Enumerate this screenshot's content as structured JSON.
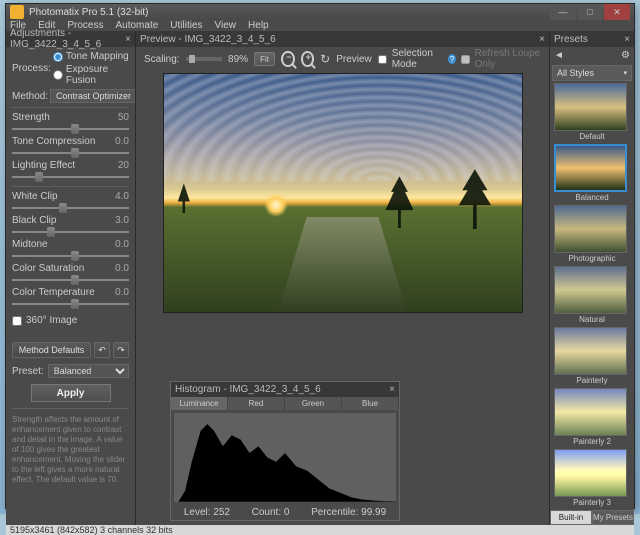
{
  "title": "Photomatix Pro 5.1 (32-bit)",
  "menu": [
    "File",
    "Edit",
    "Process",
    "Automate",
    "Utilities",
    "View",
    "Help"
  ],
  "adjust": {
    "title": "Adjustments - IMG_3422_3_4_5_6",
    "process_label": "Process:",
    "process_opts": [
      "Tone Mapping",
      "Exposure Fusion"
    ],
    "method_label": "Method:",
    "method_value": "Contrast Optimizer",
    "sliders": [
      {
        "label": "Strength",
        "value": "50",
        "pos": 50
      },
      {
        "label": "Tone Compression",
        "value": "0.0",
        "pos": 50
      },
      {
        "label": "Lighting Effect",
        "value": "20",
        "pos": 20
      }
    ],
    "sliders2": [
      {
        "label": "White Clip",
        "value": "4.0",
        "pos": 40
      },
      {
        "label": "Black Clip",
        "value": "3.0",
        "pos": 30
      },
      {
        "label": "Midtone",
        "value": "0.0",
        "pos": 50
      },
      {
        "label": "Color Saturation",
        "value": "0.0",
        "pos": 50
      },
      {
        "label": "Color Temperature",
        "value": "0.0",
        "pos": 50
      }
    ],
    "image360": "360° Image",
    "method_defaults": "Method Defaults",
    "preset_label": "Preset:",
    "preset_value": "Balanced",
    "apply": "Apply",
    "help": "Strength affects the amount of enhancement given to contrast and detail in the image. A value of 100 gives the greatest enhancement. Moving the slider to the left gives a more natural effect. The default value is 70."
  },
  "preview": {
    "title": "Preview - IMG_3422_3_4_5_6",
    "scaling_label": "Scaling:",
    "scaling_value": "89%",
    "fit": "Fit",
    "preview_label": "Preview",
    "selection_mode": "Selection Mode",
    "refresh": "Refresh Loupe Only"
  },
  "histogram": {
    "title": "Histogram - IMG_3422_3_4_5_6",
    "tabs": [
      "Luminance",
      "Red",
      "Green",
      "Blue"
    ],
    "level_label": "Level:",
    "level": "252",
    "count_label": "Count:",
    "count": "0",
    "percentile_label": "Percentile:",
    "percentile": "99.99"
  },
  "presets": {
    "title": "Presets",
    "category": "All Styles",
    "items": [
      {
        "label": "Default",
        "cls": "default"
      },
      {
        "label": "Balanced",
        "cls": "balanced",
        "selected": true
      },
      {
        "label": "Photographic",
        "cls": "photographic"
      },
      {
        "label": "Natural",
        "cls": "natural"
      },
      {
        "label": "Painterly",
        "cls": "painterly"
      },
      {
        "label": "Painterly 2",
        "cls": "painterly2"
      },
      {
        "label": "Painterly 3",
        "cls": "painterly3"
      }
    ],
    "tabs": [
      "Built-in",
      "My Presets"
    ]
  },
  "status": "5195x3461 (842x582) 3 channels 32 bits"
}
